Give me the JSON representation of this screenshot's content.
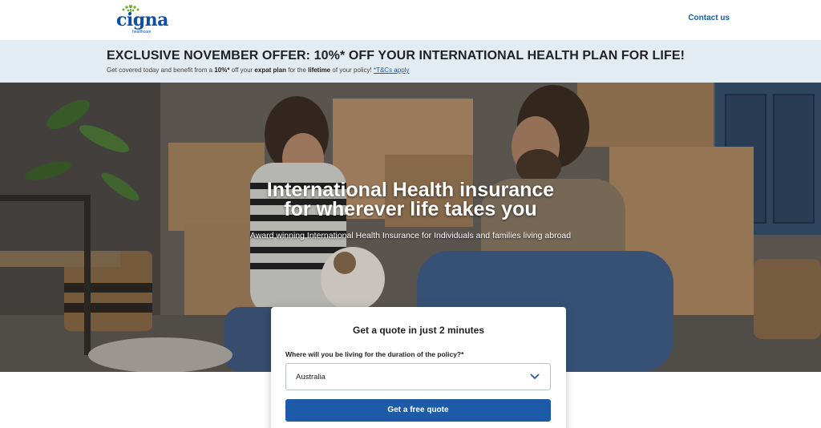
{
  "header": {
    "logo_word": "cigna",
    "logo_sub": "healthcare",
    "contact_label": "Contact us"
  },
  "offer": {
    "title": "EXCLUSIVE NOVEMBER OFFER: 10%* OFF YOUR INTERNATIONAL HEALTH PLAN FOR LIFE!",
    "text_1": "Get covered today and benefit from a ",
    "text_bold_1": "10%*",
    "text_2": " off your ",
    "text_bold_2": "expat plan",
    "text_3": " for the ",
    "text_bold_3": "lifetime",
    "text_4": " of your policy! ",
    "link": "*T&Cs apply"
  },
  "hero": {
    "title_line1": "International Health insurance",
    "title_line2": "for wherever life takes you",
    "subtitle": "Award winning International Health Insurance for Individuals and families living abroad"
  },
  "quote": {
    "title": "Get a quote in just 2 minutes",
    "label": "Where will you be living for the duration of the policy?*",
    "selected_country": "Australia",
    "button_label": "Get a free quote"
  },
  "colors": {
    "brand_blue": "#1d5ba8",
    "banner_bg": "#e3ecf2",
    "logo_green": "#6bb42d"
  },
  "icons": [
    "cigna-tree-logo",
    "chevron-down-icon"
  ]
}
